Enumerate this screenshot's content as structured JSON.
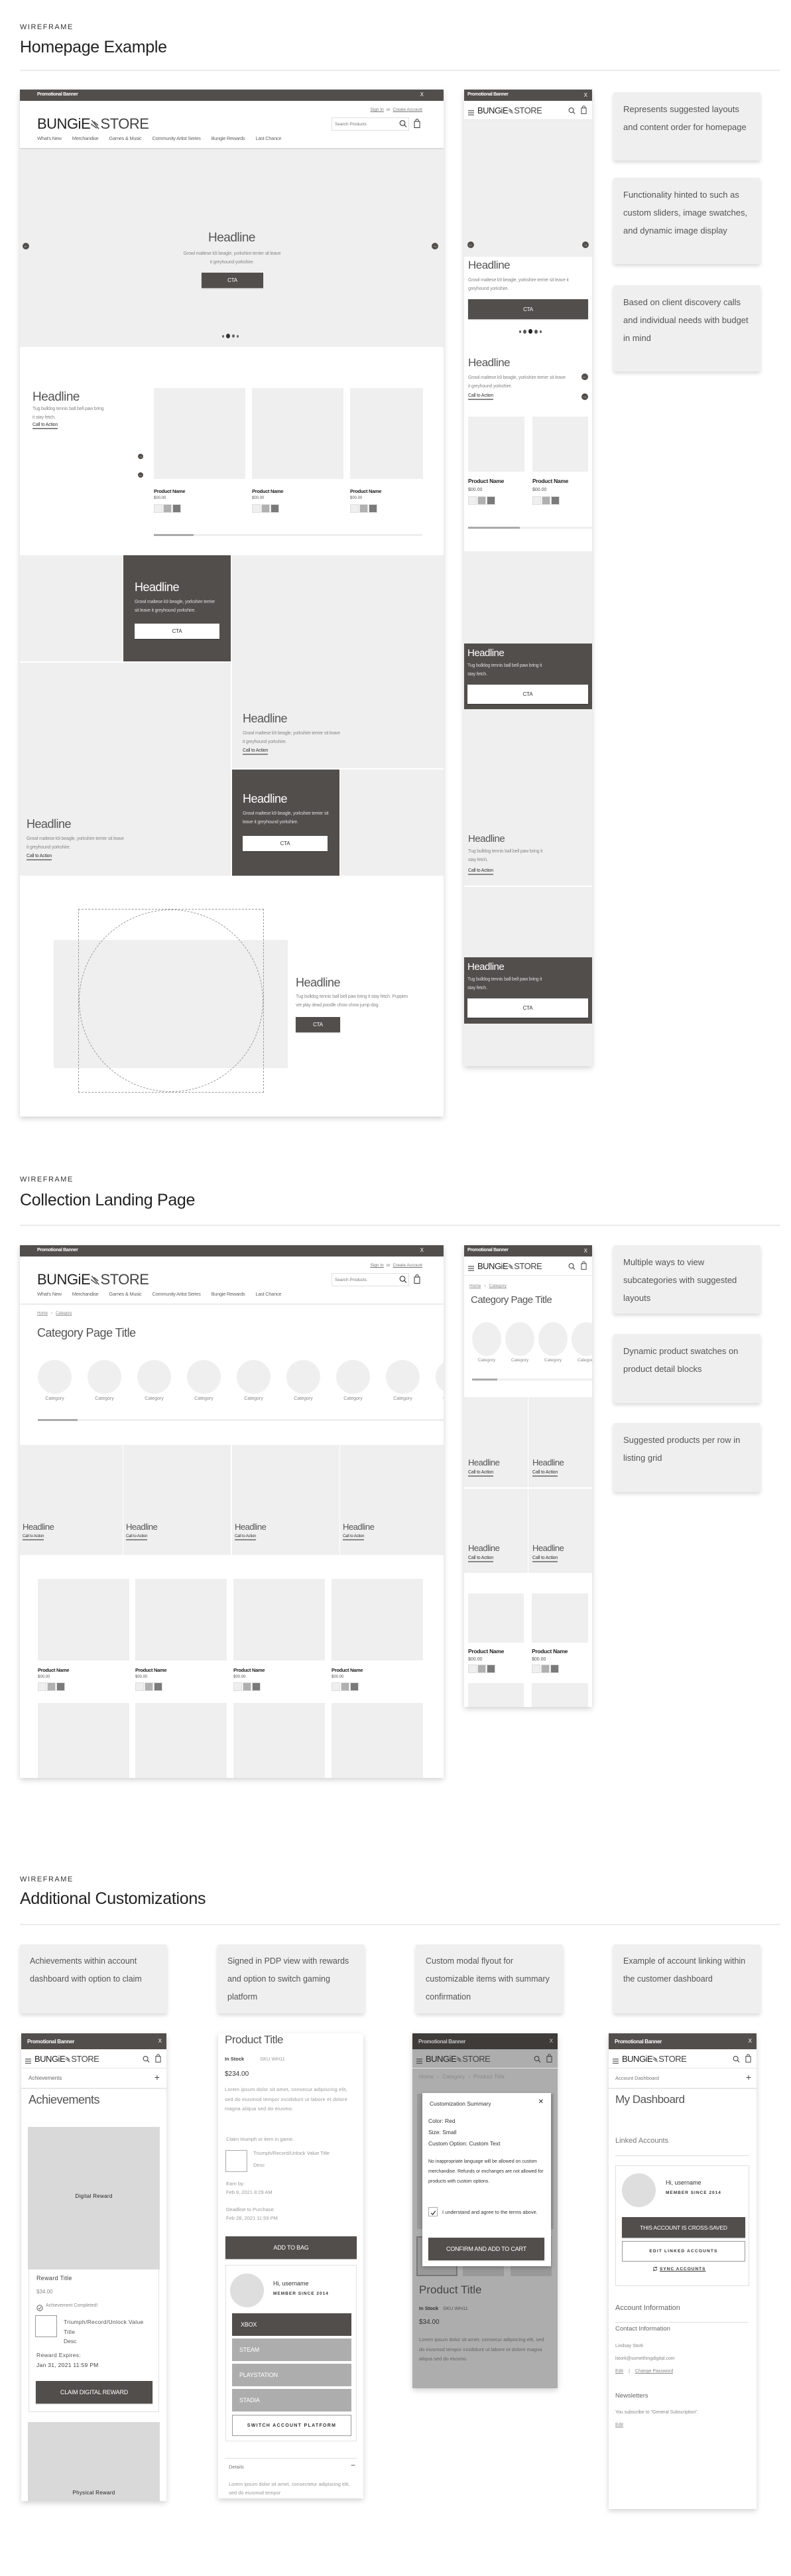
{
  "sections": [
    {
      "eyebrow": "WIREFRAME",
      "title": "Homepage Example"
    },
    {
      "eyebrow": "WIREFRAME",
      "title": "Collection Landing Page"
    },
    {
      "eyebrow": "WIREFRAME",
      "title": "Additional Customizations"
    }
  ],
  "header": {
    "promo": "Promotional Banner",
    "close": "X",
    "sign_in": "Sign In",
    "or": "or",
    "create_account": "Create Account",
    "logo_left": "BUNGiE",
    "logo_right": "STORE",
    "search_placeholder": "Search Products",
    "nav": [
      "What's New",
      "Merchandise",
      "Games & Music",
      "Community Artist Series",
      "Bungie Rewards",
      "Last Chance"
    ]
  },
  "home": {
    "hero": {
      "headline": "Headline",
      "text": "Growl maltese k9 beagle, yorkshire terrier sit leave it greyhound yorkshire.",
      "cta": "CTA"
    },
    "featured": {
      "headline": "Headline",
      "text": "Tug bulldog tennis ball bell paw bring it stay fetch.",
      "link": "Call to Action"
    },
    "products": [
      {
        "name": "Product Name",
        "price": "$00.00"
      },
      {
        "name": "Product Name",
        "price": "$00.00"
      },
      {
        "name": "Product Name",
        "price": "$00.00"
      }
    ],
    "tiles": [
      {
        "headline": "Headline",
        "text": "Growl maltese k9 beagle, yorkshire terrier sit leave it greyhound yorkshire.",
        "cta": "CTA"
      },
      {
        "headline": "Headline",
        "text": "Growl maltese k9 beagle, yorkshire terrier sit leave it greyhound yorkshire.",
        "link": "Call to Action"
      },
      {
        "headline": "Headline",
        "text": "Growl maltese k9 beagle, yorkshire terrier sit leave it greyhound yorkshire.",
        "link": "Call to Action"
      },
      {
        "headline": "Headline",
        "text": "Growl maltese k9 beagle, yorkshire terrier sit leave it greyhound yorkshire.",
        "cta": "CTA"
      }
    ],
    "split": {
      "headline": "Headline",
      "text": "Tug bulldog tennis ball bell paw bring it stay fetch. Puppies vet play dead poodle chow chow jump dog.",
      "cta": "CTA"
    },
    "mobile": {
      "hero": {
        "headline": "Headline",
        "text": "Growl maltese k9 beagle, yorkshire terrier sit leave it greyhound yorkshire.",
        "cta": "CTA"
      },
      "featured": {
        "headline": "Headline",
        "text": "Growl maltese k9 beagle, yorkshire terrier sit leave it greyhound yorkshire.",
        "link": "Call to Action"
      },
      "products": [
        {
          "name": "Product Name",
          "price": "$00.00"
        },
        {
          "name": "Product Name",
          "price": "$00.00"
        }
      ],
      "tiles": [
        {
          "headline": "Headline",
          "text": "Tug bulldog tennis ball bell paw bring it stay fetch.",
          "cta": "CTA"
        },
        {
          "headline": "Headline",
          "text": "Tug bulldog tennis ball bell paw bring it stay fetch.",
          "link": "Call to Action"
        },
        {
          "headline": "Headline",
          "text": "Tug bulldog tennis ball bell paw bring it stay fetch.",
          "cta": "CTA"
        }
      ]
    }
  },
  "collection": {
    "breadcrumb": [
      "Home",
      "Category"
    ],
    "title": "Category Page Title",
    "categories": [
      "Category",
      "Category",
      "Category",
      "Category",
      "Category",
      "Category",
      "Category",
      "Category",
      "Category"
    ],
    "tiles": [
      {
        "headline": "Headline",
        "link": "Call to Action"
      },
      {
        "headline": "Headline",
        "link": "Call to Action"
      },
      {
        "headline": "Headline",
        "link": "Call to Action"
      },
      {
        "headline": "Headline",
        "link": "Call to Action"
      }
    ],
    "products": [
      {
        "name": "Product Name",
        "price": "$00.00"
      },
      {
        "name": "Product Name",
        "price": "$00.00"
      },
      {
        "name": "Product Name",
        "price": "$00.00"
      },
      {
        "name": "Product Name",
        "price": "$00.00"
      }
    ],
    "mobile": {
      "categories": [
        "Category",
        "Category",
        "Category",
        "Category"
      ],
      "tiles": [
        {
          "headline": "Headline",
          "link": "Call to Action"
        },
        {
          "headline": "Headline",
          "link": "Call to Action"
        },
        {
          "headline": "Headline",
          "link": "Call to Action"
        },
        {
          "headline": "Headline",
          "link": "Call to Action"
        }
      ],
      "products": [
        {
          "name": "Product Name",
          "price": "$00.00"
        },
        {
          "name": "Product Name",
          "price": "$00.00"
        }
      ]
    }
  },
  "notes": {
    "home": [
      "Represents suggested layouts and content order for homepage",
      "Functionality hinted to such as custom sliders, image swatches, and dynamic image display",
      "Based on client discovery calls and individual needs with budget in mind"
    ],
    "collection": [
      "Multiple ways to view subcategories with suggested layouts",
      "Dynamic product swatches on product detail blocks",
      "Suggested products per row in listing grid"
    ],
    "custom": [
      "Achievements within account dashboard with option to claim",
      "Signed in PDP view with rewards and option to switch gaming platform",
      "Custom modal flyout for customizable items with summary confirmation",
      "Example of account linking within the customer dashboard"
    ]
  },
  "achievements": {
    "subnav": "Achievements",
    "title": "Achievements",
    "digital_reward": "Digital Reward",
    "reward_title": "Reward Title",
    "price": "$34.00",
    "status": "Achievement Completed!",
    "unlock_title": "Triumph/Record/Unlock Value Title",
    "unlock_desc": "Desc",
    "expires_label": "Reward Expires:",
    "expires_date": "Jan 31, 2021 11:59 PM",
    "claim": "CLAIM DIGITAL REWARD",
    "physical_reward": "Physical Reward"
  },
  "pdp": {
    "title": "Product Title",
    "stock": "In Stock",
    "sku": "SKU WH11",
    "price": "$234.00",
    "description": "Lorem ipsum dolor sit amet, consecur adipiscing elit, sed do eiusmod tempor incididunt ut labore et dolore magna aliqua sed do eiusmo.",
    "claim": "Claim triumph or item in game.",
    "unlock_title": "Triumph/Record/Unlock Value Title",
    "unlock_desc": "Desc",
    "earn_label": "Earn by:",
    "earn_date": "Feb 9, 2021 8:29 AM",
    "deadline_label": "Deadline to Purchase:",
    "deadline_date": "Feb 28, 2021 11:59  PM",
    "add_to_bag": "ADD TO BAG",
    "greeting": "Hi, username",
    "member": "MEMBER SINCE 2014",
    "platforms": [
      "XBOX",
      "STEAM",
      "PLAYSTATION",
      "STADIA"
    ],
    "selected_platform": "XBOX",
    "switch": "SWITCH ACCOUNT PLATFORM",
    "details": "Details",
    "details_text": "Lorem ipsum dolor sit amet, consectetur adipiscing elit, sed do eiusmod tempor"
  },
  "modal": {
    "breadcrumb": [
      "Home",
      "Category",
      "Product Title"
    ],
    "title": "Customization Summary",
    "close": "✕",
    "color": "Color: Red",
    "size": "Size: Small",
    "custom": "Custom Option: Custom Text",
    "notice": "No inappropriate language will be allowed on custom merchandise. Refunds or exchanges are not allowed for products with custom options.",
    "agree": "I understand and agree to the terms above.",
    "agree_checked": true,
    "confirm": "CONFIRM AND ADD TO CART",
    "product_title": "Product Title",
    "stock": "In Stock",
    "sku": "SKU WH11",
    "price": "$34.00",
    "description": "Lorem ipsum dolor sit amet, consecur adipiscing elit, sed do eiusmod tempor incididunt ut labore et dolore magna aliqua sed do eiusmo."
  },
  "dashboard": {
    "subnav": "Account Dashboard",
    "title": "My Dashboard",
    "linked": "Linked Accounts",
    "greeting": "Hi, username",
    "member": "MEMBER SINCE 2014",
    "cross_saved": "THIS ACCOUNT IS CROSS-SAVED",
    "edit_linked": "EDIT LINKED ACCOUNTS",
    "sync": "SYNC ACCOUNTS",
    "account_info": "Account Information",
    "contact_info": "Contact Information",
    "name": "Lindsay Stork",
    "email": "lstork@somethingdigital.com",
    "edit": "Edit",
    "separator": "|",
    "change_password": "Change Password",
    "newsletters": "Newsletters",
    "subscription": "You subscribe to \"General Subscription\".",
    "newsletter_edit": "Edit"
  },
  "colors": {
    "dark": "#524e4b",
    "placeholder": "#efefef",
    "reward": "#d9d9d9",
    "overlay": "#adadad",
    "swatch_light": "#efefef",
    "swatch_mid": "#b0b0b0",
    "swatch_dark": "#7a7a7a"
  }
}
